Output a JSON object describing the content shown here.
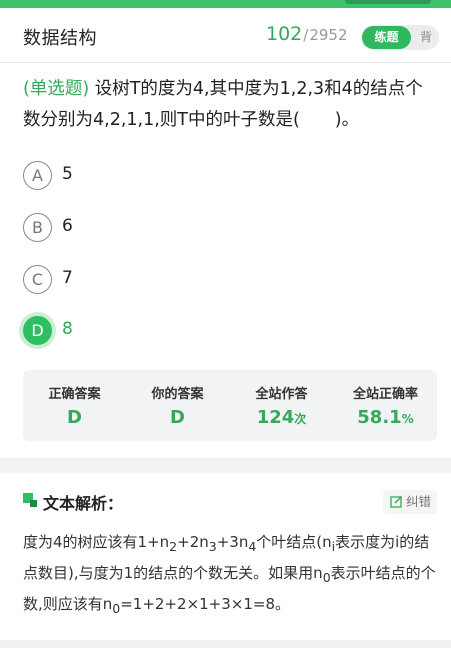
{
  "header": {
    "subject": "数据结构",
    "progress_current": "102",
    "progress_separator": "/",
    "progress_total": "2952",
    "mode_active": "练题",
    "mode_inactive": "背"
  },
  "question": {
    "type_tag": "(单选题)",
    "text": "设树T的度为4,其中度为1,2,3和4的结点个数分别为4,2,1,1,则T中的叶子数是(　　)。"
  },
  "options": [
    {
      "letter": "A",
      "text": "5",
      "state": "normal"
    },
    {
      "letter": "B",
      "text": "6",
      "state": "normal"
    },
    {
      "letter": "C",
      "text": "7",
      "state": "normal"
    },
    {
      "letter": "D",
      "text": "8",
      "state": "correct"
    }
  ],
  "stats": [
    {
      "label": "正确答案",
      "value": "D",
      "unit": ""
    },
    {
      "label": "你的答案",
      "value": "D",
      "unit": ""
    },
    {
      "label": "全站作答",
      "value": "124",
      "unit": "次"
    },
    {
      "label": "全站正确率",
      "value": "58.1",
      "unit": "%"
    }
  ],
  "analysis": {
    "title": "文本解析：",
    "correct_button": "纠错",
    "body_parts": {
      "p1": "度为4的树应该有1+n",
      "s1": "2",
      "p2": "+2n",
      "s2": "3",
      "p3": "+3n",
      "s3": "4",
      "p4": "个叶结点(n",
      "s4": "i",
      "p5": "表示度为i的结点数目),与度为1的结点的个数无关。如果用n",
      "s5": "0",
      "p6": "表示叶结点的个数,则应该有n",
      "s6": "0",
      "p7": "=1+2+2×1+3×1=8。"
    }
  },
  "colors": {
    "accent": "#35a85a",
    "accent_fill": "#2fbf63",
    "stats_bg": "#f2f3f5"
  },
  "icons": {
    "analysis": "green-square-icon",
    "correct": "edit-icon"
  }
}
